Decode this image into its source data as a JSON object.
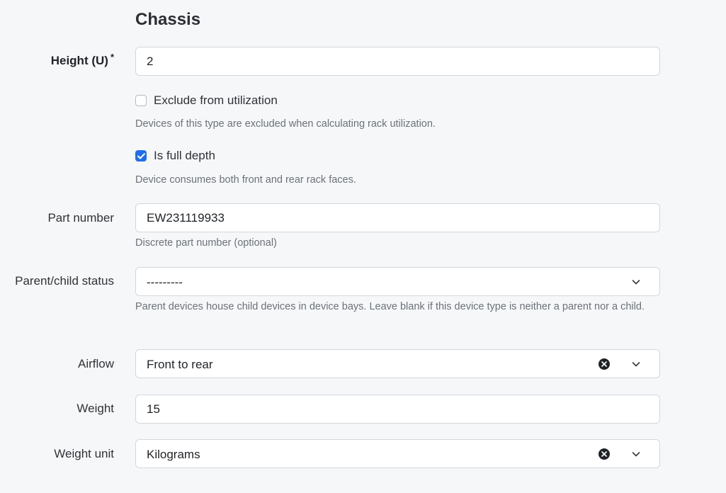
{
  "section_title": "Chassis",
  "height": {
    "label": "Height (U)",
    "required_mark": "*",
    "value": "2"
  },
  "exclude_from_utilization": {
    "label": "Exclude from utilization",
    "checked": false,
    "help": "Devices of this type are excluded when calculating rack utilization."
  },
  "is_full_depth": {
    "label": "Is full depth",
    "checked": true,
    "help": "Device consumes both front and rear rack faces."
  },
  "part_number": {
    "label": "Part number",
    "value": "EW231119933",
    "help": "Discrete part number (optional)"
  },
  "parent_child_status": {
    "label": "Parent/child status",
    "value": "---------",
    "help": "Parent devices house child devices in device bays. Leave blank if this device type is neither a parent nor a child."
  },
  "airflow": {
    "label": "Airflow",
    "value": "Front to rear"
  },
  "weight": {
    "label": "Weight",
    "value": "15"
  },
  "weight_unit": {
    "label": "Weight unit",
    "value": "Kilograms"
  },
  "icons": {
    "chevron": "chevron-down-icon",
    "clear": "clear-x-icon",
    "check": "checkmark-icon"
  },
  "colors": {
    "accent": "#1f6feb",
    "page_bg": "#f6f7f9"
  }
}
